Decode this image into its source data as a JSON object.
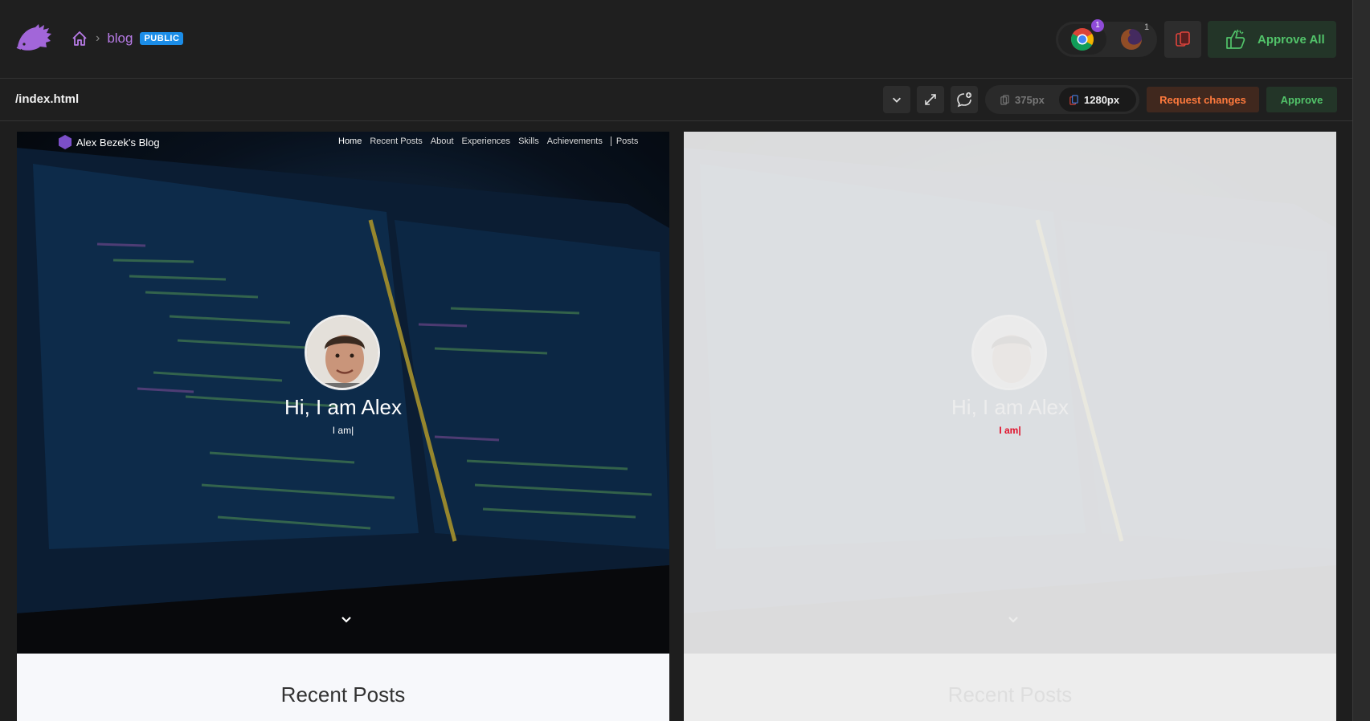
{
  "topbar": {
    "breadcrumb_project": "blog",
    "visibility_badge": "PUBLIC",
    "browsers": [
      {
        "name": "chrome",
        "count": "1"
      },
      {
        "name": "firefox",
        "count": "1"
      }
    ],
    "approve_all_label": "Approve All"
  },
  "subbar": {
    "file_path": "/index.html",
    "viewport_small": "375px",
    "viewport_large": "1280px",
    "request_changes_label": "Request changes",
    "approve_label": "Approve"
  },
  "preview": {
    "brand": "Alex Bezek's Blog",
    "nav": [
      "Home",
      "Recent Posts",
      "About",
      "Experiences",
      "Skills",
      "Achievements",
      "Posts"
    ],
    "hero_title": "Hi, I am Alex",
    "hero_subtitle": "I am|",
    "section_title": "Recent Posts"
  },
  "diff": {
    "highlight_text": "I am|"
  },
  "colors": {
    "accent_purple": "#b77be6",
    "badge_blue": "#1b8de8",
    "approve_green": "#52c46a",
    "request_orange": "#ff7a3d",
    "diff_red": "#e0102a"
  }
}
